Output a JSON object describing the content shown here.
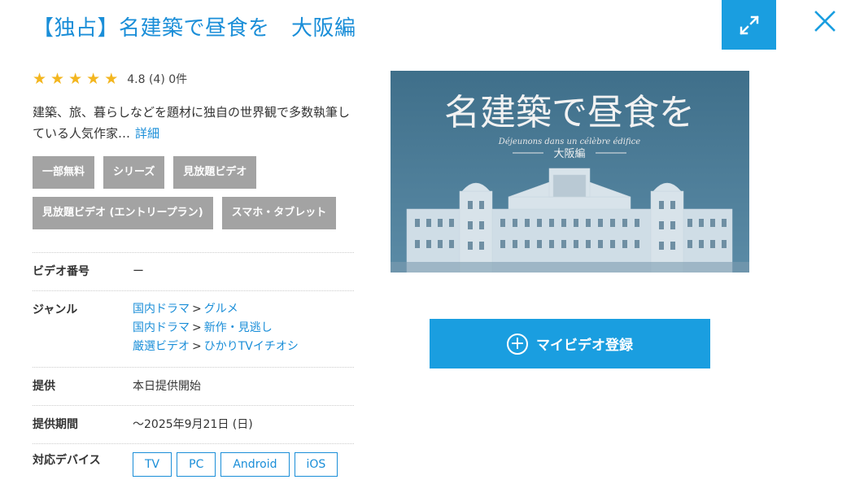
{
  "header": {
    "title": "【独占】名建築で昼食を　大阪編"
  },
  "rating": {
    "stars": 5,
    "text": "4.8 (4) 0件"
  },
  "description": {
    "text": "建築、旅、暮らしなどを題材に独自の世界観で多数執筆している人気作家…",
    "more_label": "詳細"
  },
  "tags": [
    "一部無料",
    "シリーズ",
    "見放題ビデオ",
    "見放題ビデオ (エントリープラン)",
    "スマホ・タブレット"
  ],
  "info": {
    "video_number": {
      "label": "ビデオ番号",
      "value": "ー"
    },
    "genre": {
      "label": "ジャンル",
      "items": [
        {
          "parent": "国内ドラマ",
          "sep": ">",
          "child": "グルメ"
        },
        {
          "parent": "国内ドラマ",
          "sep": ">",
          "child": "新作・見逃し"
        },
        {
          "parent": "厳選ビデオ",
          "sep": ">",
          "child": "ひかりTVイチオシ"
        }
      ]
    },
    "provision": {
      "label": "提供",
      "value": "本日提供開始"
    },
    "period": {
      "label": "提供期間",
      "value": "～2025年9月21日 (日)"
    },
    "devices": {
      "label": "対応デバイス",
      "items": [
        "TV",
        "PC",
        "Android",
        "iOS"
      ]
    }
  },
  "poster": {
    "title": "名建築で昼食を",
    "subtitle": "Déjeunons dans un célèbre édifice",
    "edition": "大阪編",
    "bg_color": "#4a7c97"
  },
  "mylist_button": {
    "label": "マイビデオ登録"
  },
  "colors": {
    "accent": "#1a9ee0",
    "link": "#1a8ed8",
    "star": "#f3b61f",
    "tag_bg": "#a3a3a3"
  }
}
